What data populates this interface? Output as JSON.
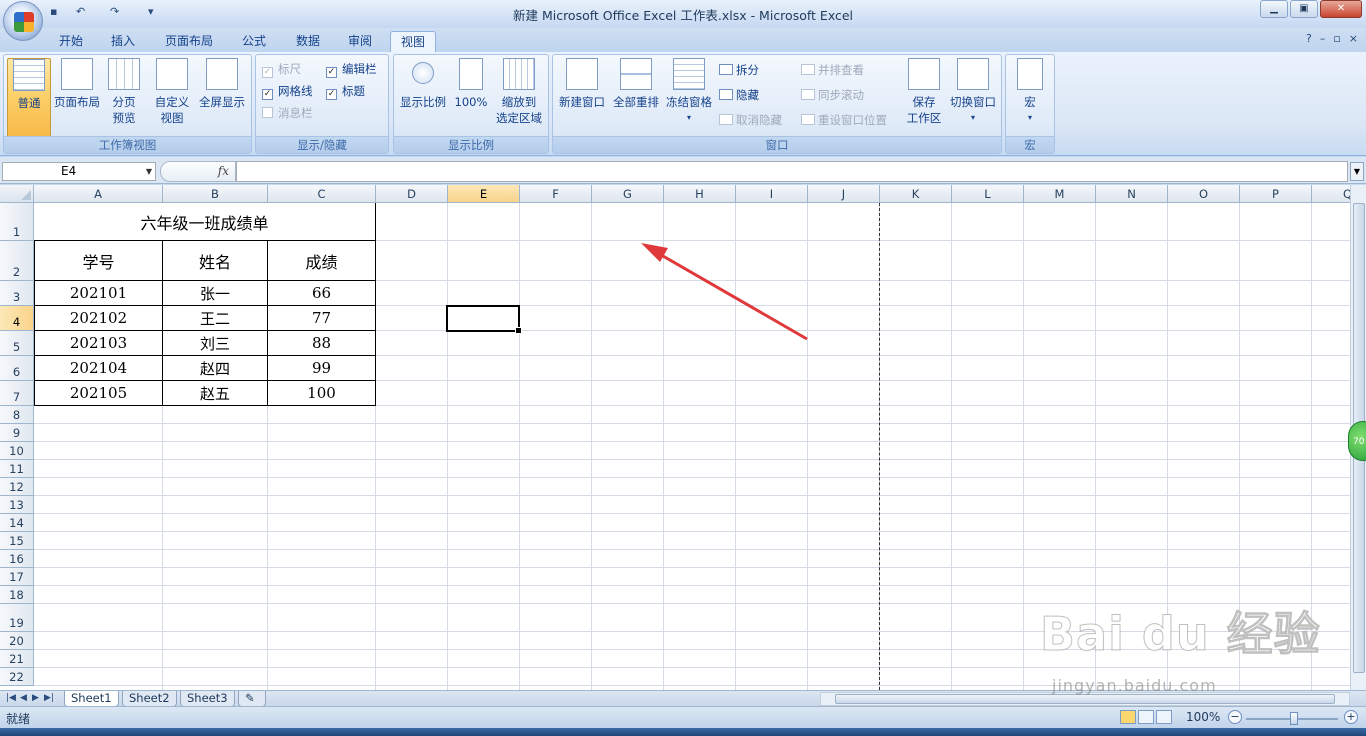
{
  "window": {
    "title": "新建 Microsoft Office Excel 工作表.xlsx - Microsoft Excel",
    "minimize": "▁",
    "maximize": "▣",
    "close": "✕"
  },
  "quick_access": {
    "save": "▪",
    "undo": "↶",
    "redo": "↷",
    "customize": "▾"
  },
  "tabs": [
    "开始",
    "插入",
    "页面布局",
    "公式",
    "数据",
    "审阅",
    "视图"
  ],
  "active_tab": "视图",
  "ribbon_right": {
    "help": "?",
    "minimize": "–",
    "restore": "▫",
    "close": "×"
  },
  "ribbon": {
    "workbook_views": {
      "label": "工作簿视图",
      "normal": "普通",
      "page_layout": "页面布局",
      "page_break_1": "分页",
      "page_break_2": "预览",
      "custom_1": "自定义",
      "custom_2": "视图",
      "full_screen": "全屏显示"
    },
    "show_hide": {
      "label": "显示/隐藏",
      "ruler": "标尺",
      "formula_bar": "编辑栏",
      "gridlines": "网格线",
      "headings": "标题",
      "message_bar": "消息栏"
    },
    "zoom": {
      "label": "显示比例",
      "zoom": "显示比例",
      "hundred": "100%",
      "to_selection_1": "缩放到",
      "to_selection_2": "选定区域"
    },
    "window": {
      "label": "窗口",
      "new_window": "新建窗口",
      "arrange_all": "全部重排",
      "freeze_panes": "冻结窗格",
      "split": "拆分",
      "hide": "隐藏",
      "unhide": "取消隐藏",
      "side_by_side": "并排查看",
      "sync_scroll": "同步滚动",
      "reset_position": "重设窗口位置",
      "save_workspace_1": "保存",
      "save_workspace_2": "工作区",
      "switch_windows": "切换窗口"
    },
    "macros": {
      "label": "宏",
      "macros": "宏"
    }
  },
  "formula_bar": {
    "name_box": "E4",
    "fx": "fx",
    "value": ""
  },
  "columns": [
    "A",
    "B",
    "C",
    "D",
    "E",
    "F",
    "G",
    "H",
    "I",
    "J",
    "K",
    "L",
    "M",
    "N",
    "O",
    "P",
    "Q"
  ],
  "active_column": "E",
  "rows": [
    "1",
    "2",
    "3",
    "4",
    "5",
    "6",
    "7",
    "8",
    "9",
    "10",
    "11",
    "12",
    "13",
    "14",
    "15",
    "16",
    "17",
    "18",
    "19",
    "20",
    "21",
    "22"
  ],
  "active_row": "4",
  "table": {
    "title": "六年级一班成绩单",
    "headers": [
      "学号",
      "姓名",
      "成绩"
    ],
    "rows": [
      [
        "202101",
        "张一",
        "66"
      ],
      [
        "202102",
        "王二",
        "77"
      ],
      [
        "202103",
        "刘三",
        "88"
      ],
      [
        "202104",
        "赵四",
        "99"
      ],
      [
        "202105",
        "赵五",
        "100"
      ]
    ]
  },
  "sheet_tabs": [
    "Sheet1",
    "Sheet2",
    "Sheet3"
  ],
  "active_sheet": "Sheet1",
  "status": {
    "ready": "就绪",
    "zoom": "100%",
    "zoom_out": "−",
    "zoom_in": "+"
  },
  "side_badge": "70",
  "watermark": {
    "brand": "Bai du 经验",
    "url": "jingyan.baidu.com"
  },
  "colors": {
    "annotation_arrow": "#e0393b",
    "active_header": "#f9d38a",
    "ribbon_text": "#15428b"
  }
}
